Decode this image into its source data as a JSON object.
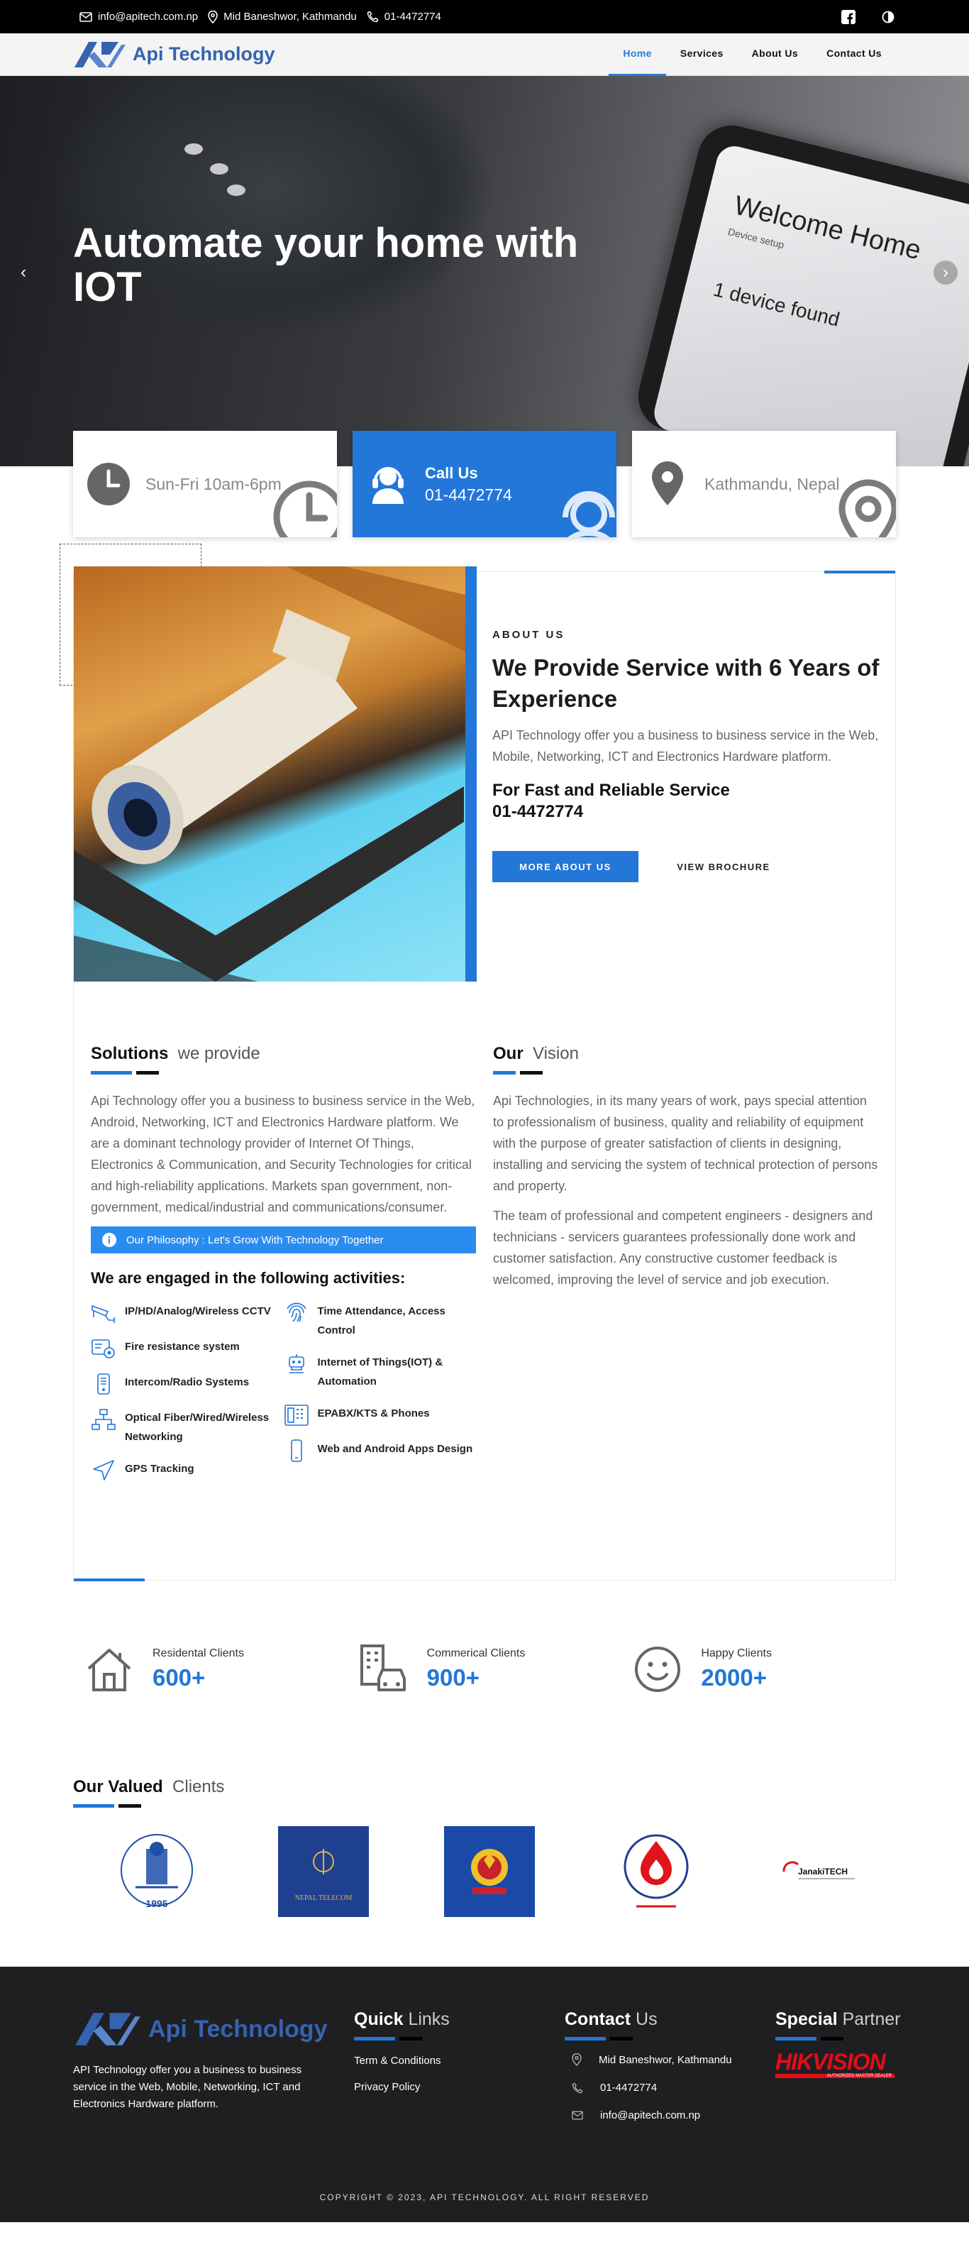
{
  "topbar": {
    "email": "info@apitech.com.np",
    "address": "Mid Baneshwor, Kathmandu",
    "phone": "01-4472774"
  },
  "brand": {
    "name": "Api Technology",
    "color": "#3563b0"
  },
  "nav": {
    "items": [
      {
        "label": "Home",
        "active": true
      },
      {
        "label": "Services"
      },
      {
        "label": "About Us"
      },
      {
        "label": "Contact Us"
      }
    ]
  },
  "hero": {
    "title": "Automate your home with IOT",
    "screen_title": "Welcome Home",
    "screen_found": "1 device found",
    "screen_small": "Device setup"
  },
  "cards": [
    {
      "text": "Sun-Fri 10am-6pm",
      "icon": "clock-icon"
    },
    {
      "title": "Call Us",
      "text": "01-4472774",
      "icon": "headset-icon"
    },
    {
      "text": "Kathmandu, Nepal",
      "icon": "map-pin-icon"
    }
  ],
  "about": {
    "eyebrow": "ABOUT US",
    "title": "We Provide Service with 6 Years of Experience",
    "description": "API Technology offer you a business to business service in the Web, Mobile, Networking, ICT and Electronics Hardware platform.",
    "reliable": "For Fast and Reliable Service",
    "reliable_phone": "01-4472774",
    "btn_more": "MORE ABOUT US",
    "btn_brochure": "VIEW BROCHURE"
  },
  "solutions": {
    "title_bold": "Solutions",
    "title_rest": "we provide",
    "text": "Api Technology offer you a business to business service in the Web, Android, Networking, ICT and Electronics Hardware platform. We are a dominant technology provider of Internet Of Things, Electronics & Communication, and Security Technologies for critical and high-reliability applications. Markets span government, non-government, medical/industrial and communications/consumer.",
    "philosophy": "Our Philosophy : Let's Grow With Technology Together",
    "activities_title": "We are engaged in the following activities:",
    "activities_left": [
      {
        "label": "IP/HD/Analog/Wireless CCTV",
        "icon": "cctv-icon"
      },
      {
        "label": "Fire resistance system",
        "icon": "fire-system-icon"
      },
      {
        "label": "Intercom/Radio Systems",
        "icon": "intercom-icon"
      },
      {
        "label": "Optical Fiber/Wired/Wireless Networking",
        "icon": "network-icon"
      },
      {
        "label": "GPS Tracking",
        "icon": "gps-icon"
      }
    ],
    "activities_right": [
      {
        "label": "Time Attendance, Access Control",
        "icon": "fingerprint-icon"
      },
      {
        "label": "Internet of Things(IOT) & Automation",
        "icon": "robot-icon"
      },
      {
        "label": "EPABX/KTS & Phones",
        "icon": "phone-system-icon"
      },
      {
        "label": "Web and Android Apps Design",
        "icon": "mobile-icon"
      }
    ]
  },
  "vision": {
    "title_bold": "Our",
    "title_rest": "Vision",
    "p1": "Api Technologies, in its many years of work, pays special attention to professionalism of business, quality and reliability of equipment with the purpose of greater satisfaction of clients in designing, installing and servicing the system of technical protection of persons and property.",
    "p2": "The team of professional and competent engineers - designers and technicians - servicers guarantees professionally done work and customer satisfaction. Any constructive customer feedback is welcomed, improving the level of service and job execution."
  },
  "counters": [
    {
      "label": "Residental Clients",
      "value": "600+",
      "icon": "house-icon"
    },
    {
      "label": "Commerical Clients",
      "value": "900+",
      "icon": "building-car-icon"
    },
    {
      "label": "Happy Clients",
      "value": "2000+",
      "icon": "smile-icon"
    }
  ],
  "clients": {
    "title_bold": "Our Valued",
    "title_rest": "Clients",
    "logos": [
      {
        "name": "forum-women-law-logo",
        "year": "1995"
      },
      {
        "name": "nepal-telecom-logo",
        "text": "NEPAL TELECOM"
      },
      {
        "name": "nepal-police-logo"
      },
      {
        "name": "nepal-oil-logo"
      },
      {
        "name": "janaki-tech-logo",
        "text": "JanakiTECH"
      }
    ]
  },
  "footer": {
    "brand": "Api Technology",
    "description": "API Technology offer you a business to business service in the Web, Mobile, Networking, ICT and Electronics Hardware platform.",
    "quick_bold": "Quick",
    "quick_rest": "Links",
    "links": [
      "Term & Conditions",
      "Privacy Policy"
    ],
    "contact_bold": "Contact",
    "contact_rest": "Us",
    "address": "Mid Baneshwor, Kathmandu",
    "phone": "01-4472774",
    "email": "info@apitech.com.np",
    "partner_bold": "Special",
    "partner_rest": "Partner",
    "partner_name": "HIKVISION",
    "partner_sub": "AUTHORIZED MASTER DEALER",
    "copyright": "COPYRIGHT © 2023, API TECHNOLOGY. ALL RIGHT RESERVED"
  },
  "colors": {
    "accent": "#2277d8",
    "topbar": "#000000",
    "footer": "#1f1f21"
  }
}
